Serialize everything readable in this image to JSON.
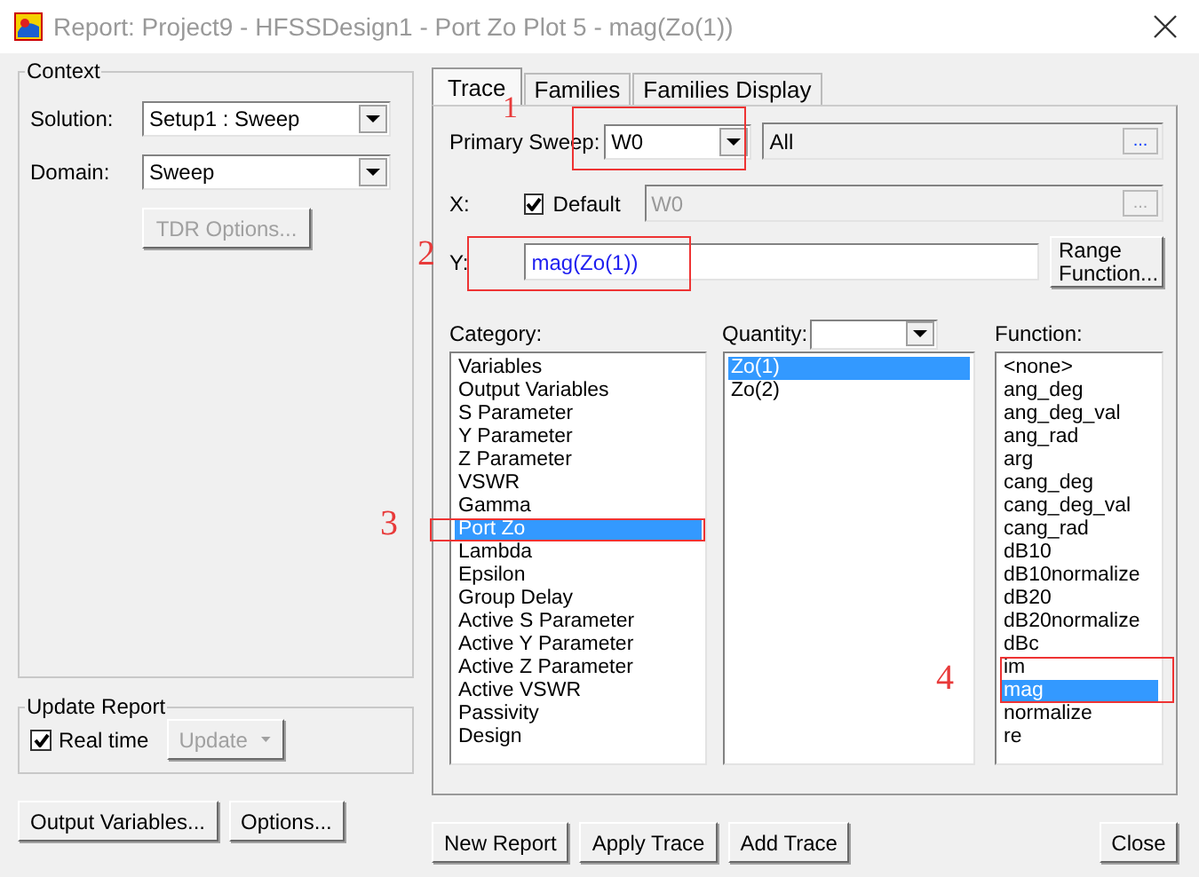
{
  "window": {
    "title": "Report: Project9 - HFSSDesign1 - Port Zo Plot 5 - mag(Zo(1))"
  },
  "context": {
    "title": "Context",
    "solution": {
      "label": "Solution:",
      "value": "Setup1 : Sweep"
    },
    "domain": {
      "label": "Domain:",
      "value": "Sweep"
    },
    "tdr_button": {
      "label": "TDR Options...",
      "disabled": true
    }
  },
  "update_report": {
    "title": "Update Report",
    "real_time": {
      "label": "Real time",
      "checked": true
    },
    "update_button": {
      "label": "Update",
      "disabled": true
    }
  },
  "left_buttons": [
    "Output Variables...",
    "Options..."
  ],
  "tabs": [
    {
      "label": "Trace",
      "selected": true
    },
    {
      "label": "Families",
      "selected": false
    },
    {
      "label": "Families Display",
      "selected": false
    }
  ],
  "trace": {
    "primary_sweep": {
      "label": "Primary Sweep:",
      "value": "W0",
      "range": "All",
      "browse": "..."
    },
    "x": {
      "label": "X:",
      "default": {
        "label": "Default",
        "checked": true
      },
      "value": "W0",
      "disabled": true,
      "browse": "..."
    },
    "y": {
      "label": "Y:",
      "value": "mag(Zo(1))"
    },
    "range_function_button": "Range Function...",
    "category": {
      "label": "Category:",
      "items": [
        {
          "label": "Variables",
          "selected": false
        },
        {
          "label": "Output Variables",
          "selected": false
        },
        {
          "label": "S Parameter",
          "selected": false
        },
        {
          "label": "Y Parameter",
          "selected": false
        },
        {
          "label": "Z Parameter",
          "selected": false
        },
        {
          "label": "VSWR",
          "selected": false
        },
        {
          "label": "Gamma",
          "selected": false
        },
        {
          "label": "Port Zo",
          "selected": true
        },
        {
          "label": "Lambda",
          "selected": false
        },
        {
          "label": "Epsilon",
          "selected": false
        },
        {
          "label": "Group Delay",
          "selected": false
        },
        {
          "label": "Active S Parameter",
          "selected": false
        },
        {
          "label": "Active Y Parameter",
          "selected": false
        },
        {
          "label": "Active Z Parameter",
          "selected": false
        },
        {
          "label": "Active VSWR",
          "selected": false
        },
        {
          "label": "Passivity",
          "selected": false
        },
        {
          "label": "Design",
          "selected": false
        }
      ]
    },
    "quantity": {
      "label": "Quantity:",
      "items": [
        {
          "label": "Zo(1)",
          "selected": true
        },
        {
          "label": "Zo(2)",
          "selected": false
        }
      ]
    },
    "function": {
      "label": "Function:",
      "items": [
        {
          "label": "<none>",
          "selected": false
        },
        {
          "label": "ang_deg",
          "selected": false
        },
        {
          "label": "ang_deg_val",
          "selected": false
        },
        {
          "label": "ang_rad",
          "selected": false
        },
        {
          "label": "arg",
          "selected": false
        },
        {
          "label": "cang_deg",
          "selected": false
        },
        {
          "label": "cang_deg_val",
          "selected": false
        },
        {
          "label": "cang_rad",
          "selected": false
        },
        {
          "label": "dB10",
          "selected": false
        },
        {
          "label": "dB10normalize",
          "selected": false
        },
        {
          "label": "dB20",
          "selected": false
        },
        {
          "label": "dB20normalize",
          "selected": false
        },
        {
          "label": "dBc",
          "selected": false
        },
        {
          "label": "im",
          "selected": false
        },
        {
          "label": "mag",
          "selected": true
        },
        {
          "label": "normalize",
          "selected": false
        },
        {
          "label": "re",
          "selected": false
        }
      ]
    }
  },
  "bottom_buttons": [
    "New Report",
    "Apply Trace",
    "Add Trace"
  ],
  "close_button": "Close",
  "annotations": [
    {
      "label": "1"
    },
    {
      "label": "2"
    },
    {
      "label": "3"
    },
    {
      "label": "4"
    }
  ]
}
